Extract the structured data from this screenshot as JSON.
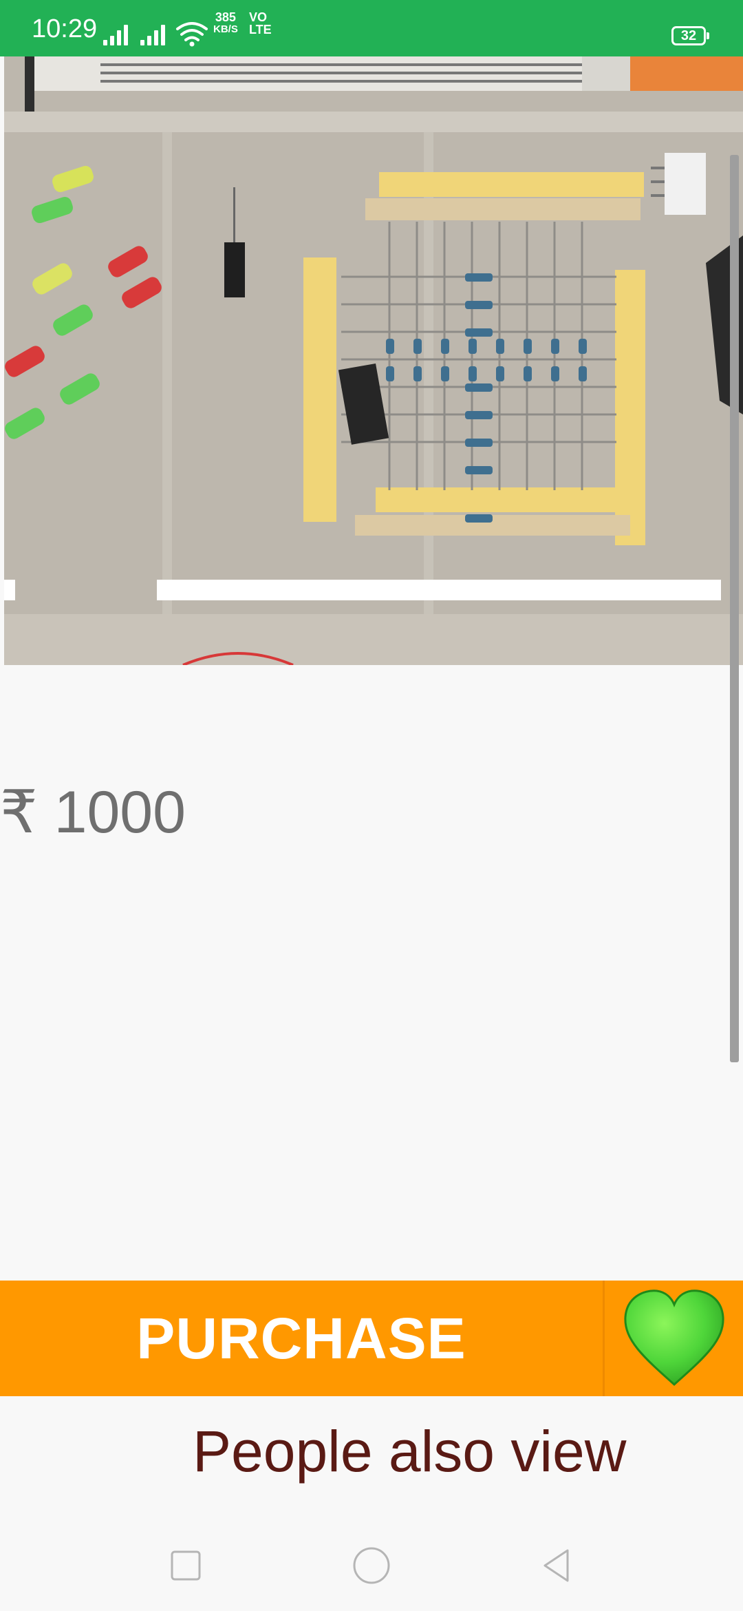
{
  "status_bar": {
    "time": "10:29",
    "net_speed_value": "385",
    "net_speed_unit": "KB/S",
    "volte_line1": "VO",
    "volte_line2": "LTE",
    "battery": "32",
    "background_color": "#22b155"
  },
  "product": {
    "image_icon": "product-photo",
    "price": "₹ 1000"
  },
  "purchase_bar": {
    "purchase_label": "PURCHASE",
    "wishlist_icon": "green-heart-icon",
    "background_color": "#ff9800"
  },
  "related": {
    "heading": "People also view"
  },
  "nav_bar": {
    "recents_icon": "square-icon",
    "home_icon": "circle-icon",
    "back_icon": "triangle-back-icon"
  }
}
